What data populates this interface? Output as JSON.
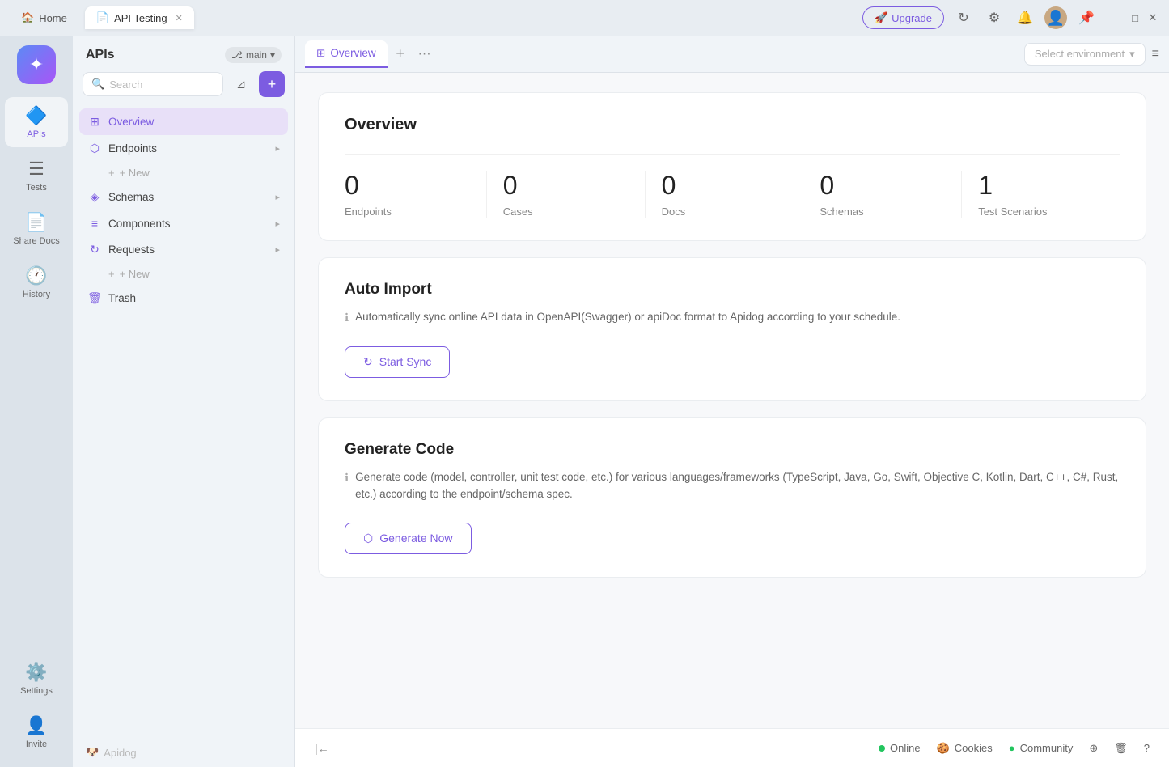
{
  "titlebar": {
    "tabs": [
      {
        "id": "home",
        "label": "Home",
        "icon": "🏠",
        "active": false,
        "closable": false
      },
      {
        "id": "api-testing",
        "label": "API Testing",
        "active": true,
        "closable": true
      }
    ],
    "upgrade_label": "Upgrade",
    "window_controls": [
      "—",
      "□",
      "✕"
    ]
  },
  "icon_sidebar": {
    "items": [
      {
        "id": "apis",
        "icon": "🔷",
        "label": "APIs",
        "active": true
      },
      {
        "id": "tests",
        "icon": "☰",
        "label": "Tests",
        "active": false
      },
      {
        "id": "share-docs",
        "icon": "📄",
        "label": "Share Docs",
        "active": false
      },
      {
        "id": "history",
        "icon": "🕐",
        "label": "History",
        "active": false
      },
      {
        "id": "settings",
        "icon": "⚙️",
        "label": "Settings",
        "active": false
      }
    ],
    "bottom_items": [
      {
        "id": "invite",
        "icon": "👤+",
        "label": "Invite"
      }
    ]
  },
  "nav_panel": {
    "title": "APIs",
    "branch": "main",
    "search_placeholder": "Search",
    "items": [
      {
        "id": "overview",
        "label": "Overview",
        "icon": "⊞",
        "active": true,
        "expandable": false
      },
      {
        "id": "endpoints",
        "label": "Endpoints",
        "icon": "⬡",
        "active": false,
        "expandable": true
      },
      {
        "id": "new-endpoint",
        "label": "+ New",
        "indent": true
      },
      {
        "id": "schemas",
        "label": "Schemas",
        "icon": "◈",
        "active": false,
        "expandable": true
      },
      {
        "id": "components",
        "label": "Components",
        "icon": "≡",
        "active": false,
        "expandable": true
      },
      {
        "id": "requests",
        "label": "Requests",
        "icon": "↻",
        "active": false,
        "expandable": true
      },
      {
        "id": "new-request",
        "label": "+ New",
        "indent": true
      },
      {
        "id": "trash",
        "label": "Trash",
        "icon": "🗑",
        "active": false,
        "expandable": false
      }
    ],
    "footer_label": "Apidog"
  },
  "content": {
    "tab_label": "Overview",
    "tab_icon": "⊞",
    "env_placeholder": "Select environment",
    "overview": {
      "title": "Overview",
      "stats": [
        {
          "id": "endpoints",
          "value": "0",
          "label": "Endpoints"
        },
        {
          "id": "cases",
          "value": "0",
          "label": "Cases"
        },
        {
          "id": "docs",
          "value": "0",
          "label": "Docs"
        },
        {
          "id": "schemas",
          "value": "0",
          "label": "Schemas"
        },
        {
          "id": "test-scenarios",
          "value": "1",
          "label": "Test Scenarios"
        }
      ]
    },
    "auto_import": {
      "title": "Auto Import",
      "description": "Automatically sync online API data in OpenAPI(Swagger) or apiDoc format to Apidog according to your schedule.",
      "button_label": "Start Sync",
      "button_icon": "↻"
    },
    "generate_code": {
      "title": "Generate Code",
      "description": "Generate code (model, controller, unit test code, etc.) for various languages/frameworks (TypeScript, Java, Go, Swift, Objective C, Kotlin, Dart, C++, C#, Rust, etc.) according to the endpoint/schema spec.",
      "button_label": "Generate Now",
      "button_icon": "⬡"
    }
  },
  "footer": {
    "collapse_icon": "|←",
    "online_label": "Online",
    "cookies_label": "Cookies",
    "community_label": "Community",
    "icons": [
      "⊕",
      "🗑",
      "?"
    ]
  }
}
